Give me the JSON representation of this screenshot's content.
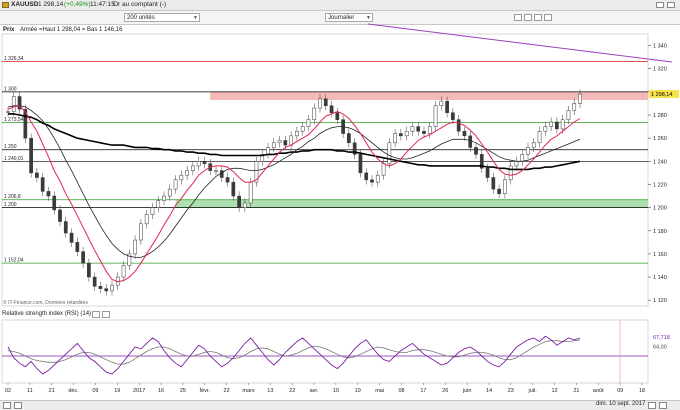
{
  "header": {
    "symbol": "XAUUSD",
    "price": "1 298,14",
    "change": "(+0,49%)",
    "time": "11:47:15",
    "instrument": "Or au comptant (-)"
  },
  "toolbar": {
    "units": "200 unités",
    "period": "Journalier"
  },
  "price_panel": {
    "legend_label": "Prix",
    "legend_text": "Année =Haut 1 298,04 = Bas 1 146,16",
    "source": "© IT-Finance.com, Données retardées"
  },
  "rsi_panel": {
    "title": "Relative strength index (RSI) (14)"
  },
  "bottom": {
    "date_box": "dim. 10 sept. 2017"
  },
  "colors": {
    "candle": "#3a3a3a",
    "ma_short": "#e0284f",
    "ma_mid": "#222222",
    "ma_long": "#000000",
    "rsi": "#7a1fa2",
    "rsi_signal": "#777777",
    "trend": "#a040c0",
    "resistance_zone": "#f4a7a7",
    "support_zone": "#9ad79a",
    "current_price": "#f6e24a"
  },
  "chart_data": [
    {
      "type": "candlestick",
      "title": "XAUUSD",
      "y_ticks": [
        1120,
        1140,
        1160,
        1180,
        1200,
        1220,
        1240,
        1260,
        1280,
        1300,
        1320,
        1340
      ],
      "ylim": [
        1115,
        1350
      ],
      "x_ticks": [
        "02",
        "11",
        "21",
        "déc.",
        "09",
        "19",
        "2017",
        "16",
        "25",
        "févr.",
        "22",
        "mars",
        "13",
        "22",
        "avr.",
        "10",
        "19",
        "mai",
        "08",
        "17",
        "26",
        "juin",
        "14",
        "23",
        "juil.",
        "12",
        "21",
        "août",
        "09",
        "18"
      ],
      "current_price": 1298.14,
      "horizontal_levels": [
        {
          "label": "1 326,34",
          "value": 1326.34,
          "color": "#d62020"
        },
        {
          "label": "1 300",
          "value": 1300,
          "color": "#000000"
        },
        {
          "label": "1 273,54",
          "value": 1273.54,
          "color": "#2aa02a"
        },
        {
          "label": "1 250",
          "value": 1250,
          "color": "#000000"
        },
        {
          "label": "1 240,01",
          "value": 1240.01,
          "color": "#000000"
        },
        {
          "label": "1 206,8",
          "value": 1206.8,
          "color": "#2aa02a"
        },
        {
          "label": "1 200",
          "value": 1200,
          "color": "#000000"
        },
        {
          "label": "1 152,04",
          "value": 1152.04,
          "color": "#2aa02a"
        }
      ],
      "zones": [
        {
          "from": 1293,
          "to": 1300,
          "start_index": 35
        },
        {
          "from": 1200,
          "to": 1206.8,
          "start_index": 29
        }
      ],
      "closes": [
        1283,
        1296,
        1285,
        1260,
        1230,
        1226,
        1214,
        1210,
        1198,
        1188,
        1178,
        1170,
        1162,
        1152,
        1140,
        1132,
        1130,
        1128,
        1133,
        1140,
        1150,
        1160,
        1172,
        1186,
        1194,
        1200,
        1206,
        1210,
        1216,
        1224,
        1228,
        1232,
        1236,
        1240,
        1238,
        1232,
        1232,
        1226,
        1222,
        1210,
        1200,
        1204,
        1222,
        1240,
        1246,
        1252,
        1256,
        1258,
        1254,
        1262,
        1266,
        1270,
        1276,
        1286,
        1294,
        1288,
        1282,
        1276,
        1264,
        1256,
        1246,
        1230,
        1224,
        1222,
        1228,
        1238,
        1256,
        1264,
        1262,
        1266,
        1270,
        1266,
        1264,
        1270,
        1288,
        1292,
        1282,
        1276,
        1266,
        1262,
        1252,
        1246,
        1234,
        1226,
        1216,
        1212,
        1224,
        1236,
        1240,
        1246,
        1252,
        1256,
        1266,
        1270,
        1274,
        1268,
        1276,
        1284,
        1290,
        1298
      ],
      "ma_short": [
        1285,
        1287,
        1288,
        1283,
        1274,
        1266,
        1255,
        1244,
        1232,
        1223,
        1212,
        1203,
        1193,
        1183,
        1173,
        1163,
        1154,
        1145,
        1138,
        1136,
        1137,
        1140,
        1145,
        1152,
        1160,
        1168,
        1176,
        1185,
        1193,
        1202,
        1208,
        1215,
        1221,
        1228,
        1232,
        1235,
        1236,
        1236,
        1235,
        1231,
        1226,
        1222,
        1222,
        1224,
        1230,
        1236,
        1242,
        1248,
        1252,
        1254,
        1257,
        1260,
        1263,
        1268,
        1274,
        1279,
        1281,
        1283,
        1281,
        1277,
        1271,
        1264,
        1256,
        1248,
        1242,
        1238,
        1236,
        1238,
        1242,
        1248,
        1253,
        1258,
        1261,
        1263,
        1266,
        1269,
        1272,
        1274,
        1273,
        1271,
        1267,
        1262,
        1255,
        1248,
        1240,
        1233,
        1229,
        1228,
        1229,
        1232,
        1237,
        1242,
        1248,
        1254,
        1259,
        1262,
        1266,
        1270,
        1274,
        1277
      ],
      "ma_mid": [
        1287,
        1288,
        1288,
        1287,
        1284,
        1280,
        1275,
        1268,
        1260,
        1251,
        1241,
        1232,
        1222,
        1212,
        1202,
        1193,
        1184,
        1176,
        1169,
        1164,
        1160,
        1158,
        1157,
        1157,
        1159,
        1162,
        1166,
        1171,
        1177,
        1184,
        1191,
        1198,
        1204,
        1211,
        1217,
        1222,
        1227,
        1230,
        1233,
        1234,
        1234,
        1233,
        1232,
        1232,
        1233,
        1235,
        1237,
        1240,
        1243,
        1246,
        1250,
        1253,
        1257,
        1260,
        1264,
        1267,
        1269,
        1270,
        1270,
        1269,
        1267,
        1264,
        1260,
        1256,
        1252,
        1248,
        1245,
        1243,
        1242,
        1242,
        1243,
        1245,
        1247,
        1249,
        1252,
        1255,
        1257,
        1259,
        1259,
        1259,
        1258,
        1256,
        1253,
        1250,
        1247,
        1244,
        1242,
        1241,
        1240,
        1240,
        1241,
        1243,
        1245,
        1247,
        1249,
        1251,
        1253,
        1255,
        1257,
        1259
      ],
      "ma_long": [
        1281,
        1281,
        1280,
        1279,
        1278,
        1276,
        1273,
        1271,
        1268,
        1266,
        1264,
        1262,
        1260,
        1259,
        1258,
        1257,
        1256,
        1255,
        1254,
        1254,
        1254,
        1253,
        1252,
        1252,
        1252,
        1251,
        1251,
        1250,
        1250,
        1249,
        1249,
        1248,
        1248,
        1247,
        1247,
        1246,
        1246,
        1245,
        1245,
        1245,
        1245,
        1245,
        1245,
        1245,
        1245,
        1246,
        1246,
        1247,
        1247,
        1248,
        1248,
        1249,
        1249,
        1250,
        1250,
        1250,
        1250,
        1249,
        1249,
        1248,
        1248,
        1247,
        1246,
        1245,
        1244,
        1243,
        1242,
        1241,
        1240,
        1239,
        1238,
        1237,
        1237,
        1236,
        1236,
        1236,
        1236,
        1236,
        1236,
        1236,
        1236,
        1236,
        1236,
        1235,
        1235,
        1234,
        1234,
        1233,
        1233,
        1233,
        1233,
        1234,
        1234,
        1235,
        1235,
        1236,
        1237,
        1238,
        1239,
        1240
      ]
    },
    {
      "type": "line",
      "title": "Relative strength index (RSI) (14)",
      "ylim": [
        20,
        90
      ],
      "levels": [
        {
          "value": 50,
          "label": ""
        }
      ],
      "last_values": [
        {
          "label": "67,718",
          "value": 67.718
        },
        {
          "label": "64,00",
          "value": 64.0
        }
      ],
      "rsi": [
        60,
        48,
        42,
        38,
        44,
        36,
        30,
        34,
        40,
        46,
        52,
        58,
        64,
        56,
        48,
        44,
        38,
        32,
        30,
        36,
        44,
        52,
        60,
        58,
        64,
        70,
        66,
        56,
        48,
        42,
        38,
        46,
        54,
        62,
        58,
        50,
        44,
        38,
        42,
        48,
        56,
        64,
        70,
        62,
        54,
        46,
        40,
        46,
        54,
        60,
        66,
        70,
        64,
        58,
        52,
        46,
        40,
        36,
        42,
        50,
        58,
        64,
        68,
        60,
        52,
        46,
        44,
        50,
        56,
        60,
        64,
        58,
        52,
        48,
        44,
        40,
        42,
        48,
        54,
        58,
        60,
        56,
        50,
        44,
        40,
        38,
        44,
        52,
        60,
        64,
        68,
        70,
        66,
        72,
        68,
        62,
        66,
        70,
        68,
        70
      ],
      "signal": [
        56,
        55,
        53,
        50,
        47,
        45,
        44,
        43,
        43,
        44,
        46,
        49,
        52,
        54,
        54,
        52,
        49,
        46,
        43,
        41,
        41,
        43,
        47,
        51,
        55,
        58,
        60,
        60,
        58,
        55,
        52,
        50,
        50,
        52,
        54,
        55,
        54,
        51,
        48,
        47,
        48,
        51,
        55,
        58,
        59,
        58,
        55,
        52,
        50,
        51,
        53,
        56,
        59,
        61,
        60,
        58,
        55,
        52,
        49,
        48,
        49,
        52,
        55,
        58,
        60,
        59,
        57,
        55,
        54,
        54,
        56,
        57,
        57,
        56,
        54,
        52,
        50,
        49,
        49,
        51,
        53,
        54,
        54,
        53,
        51,
        48,
        46,
        46,
        48,
        52,
        56,
        60,
        63,
        66,
        67,
        67,
        66,
        66,
        67,
        68
      ]
    }
  ]
}
